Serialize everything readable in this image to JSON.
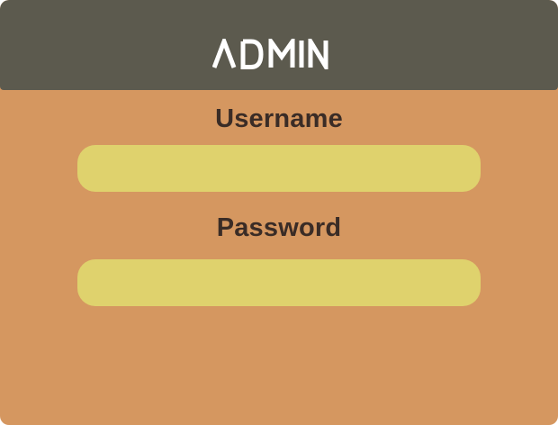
{
  "header": {
    "title": "ADMIN"
  },
  "form": {
    "username": {
      "label": "Username",
      "value": "",
      "placeholder": ""
    },
    "password": {
      "label": "Password",
      "value": "",
      "placeholder": ""
    }
  },
  "colors": {
    "header_bg": "#5c5a4e",
    "panel_bg": "#d59760",
    "field_bg": "#dfd26d",
    "label_text": "#3a2c26",
    "logo_text": "#ffffff"
  }
}
